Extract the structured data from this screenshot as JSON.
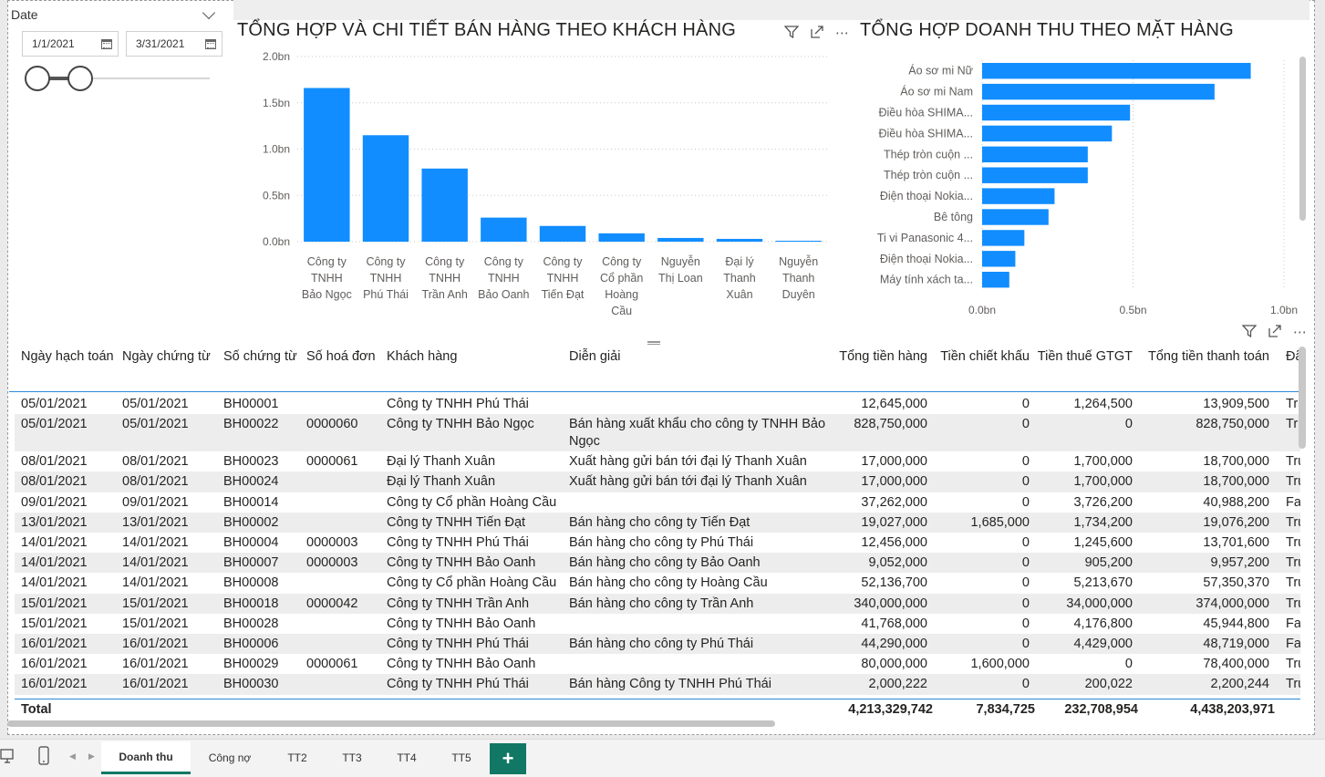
{
  "slicer": {
    "title": "Date",
    "start": "1/1/2021",
    "end": "3/31/2021"
  },
  "chart1": {
    "title": "TỔNG HỢP VÀ CHI TIẾT BÁN HÀNG THEO KHÁCH HÀNG",
    "y_ticks": [
      "2.0bn",
      "1.5bn",
      "1.0bn",
      "0.5bn",
      "0.0bn"
    ]
  },
  "chart2": {
    "title": "TỔNG HỢP DOANH THU THEO MẶT HÀNG",
    "x_ticks": [
      "0.0bn",
      "0.5bn",
      "1.0bn"
    ]
  },
  "chart_data": [
    {
      "type": "bar",
      "title": "TỔNG HỢP VÀ CHI TIẾT BÁN HÀNG THEO KHÁCH HÀNG",
      "categories": [
        [
          "Công ty",
          "TNHH",
          "Bảo Ngọc"
        ],
        [
          "Công ty",
          "TNHH",
          "Phú Thái"
        ],
        [
          "Công ty",
          "TNHH",
          "Trần Anh"
        ],
        [
          "Công ty",
          "TNHH",
          "Bảo Oanh"
        ],
        [
          "Công ty",
          "TNHH",
          "Tiến Đạt"
        ],
        [
          "Công ty",
          "Cổ phần",
          "Hoàng",
          "Cầu"
        ],
        [
          "Nguyễn",
          "Thị Loan"
        ],
        [
          "Đại lý",
          "Thanh",
          "Xuân"
        ],
        [
          "Nguyễn",
          "Thanh",
          "Duyên"
        ]
      ],
      "values": [
        1.66,
        1.15,
        0.79,
        0.26,
        0.17,
        0.09,
        0.04,
        0.03,
        0.01
      ],
      "ylim": [
        0,
        2.0
      ],
      "color": "#118dff"
    },
    {
      "type": "bar",
      "orientation": "horizontal",
      "title": "TỔNG HỢP DOANH THU THEO MẶT HÀNG",
      "categories": [
        "Áo sơ mi Nữ",
        "Áo sơ mi Nam",
        "Điều hòa SHIMA...",
        "Điều hòa SHIMA...",
        "Thép tròn cuộn ...",
        "Thép tròn cuộn ...",
        "Điện thoại Nokia...",
        "Bê tông",
        "Ti vi Panasonic 4...",
        "Điện thoại Nokia...",
        "Máy tính xách ta..."
      ],
      "values": [
        0.89,
        0.77,
        0.49,
        0.43,
        0.35,
        0.35,
        0.24,
        0.22,
        0.14,
        0.11,
        0.09
      ],
      "xlim": [
        0,
        1.0
      ],
      "color": "#118dff"
    }
  ],
  "table": {
    "headers": [
      "Ngày hạch toán",
      "Ngày chứng từ",
      "Số chứng từ",
      "Số hoá đơn",
      "Khách hàng",
      "Diễn giải",
      "Tổng tiền hàng",
      "Tiền chiết khấu",
      "Tiền thuế GTGT",
      "Tổng tiền thanh toán",
      "Đã"
    ],
    "rows": [
      [
        "05/01/2021",
        "05/01/2021",
        "BH00001",
        "",
        "Công ty TNHH Phú Thái",
        "",
        "12,645,000",
        "0",
        "1,264,500",
        "13,909,500",
        "Tru"
      ],
      [
        "05/01/2021",
        "05/01/2021",
        "BH00022",
        "0000060",
        "Công ty TNHH Bảo Ngọc",
        "Bán hàng xuất khẩu cho công ty TNHH Bảo Ngọc",
        "828,750,000",
        "0",
        "0",
        "828,750,000",
        "Tru"
      ],
      [
        "08/01/2021",
        "08/01/2021",
        "BH00023",
        "0000061",
        "Đại lý Thanh Xuân",
        "Xuất hàng gửi bán tới đại lý Thanh Xuân",
        "17,000,000",
        "0",
        "1,700,000",
        "18,700,000",
        "Tru"
      ],
      [
        "08/01/2021",
        "08/01/2021",
        "BH00024",
        "",
        "Đại lý Thanh Xuân",
        "Xuất hàng gửi bán tới đại lý Thanh Xuân",
        "17,000,000",
        "0",
        "1,700,000",
        "18,700,000",
        "Tru"
      ],
      [
        "09/01/2021",
        "09/01/2021",
        "BH00014",
        "",
        "Công ty Cổ phần Hoàng Cầu",
        "",
        "37,262,000",
        "0",
        "3,726,200",
        "40,988,200",
        "Fa"
      ],
      [
        "13/01/2021",
        "13/01/2021",
        "BH00002",
        "",
        "Công ty TNHH Tiến Đạt",
        "Bán hàng cho công ty Tiến Đạt",
        "19,027,000",
        "1,685,000",
        "1,734,200",
        "19,076,200",
        "Tru"
      ],
      [
        "14/01/2021",
        "14/01/2021",
        "BH00004",
        "0000003",
        "Công ty TNHH Phú Thái",
        "Bán hàng cho công ty Phú Thái",
        "12,456,000",
        "0",
        "1,245,600",
        "13,701,600",
        "Tru"
      ],
      [
        "14/01/2021",
        "14/01/2021",
        "BH00007",
        "0000003",
        "Công ty TNHH Bảo Oanh",
        "Bán hàng cho công ty Bảo Oanh",
        "9,052,000",
        "0",
        "905,200",
        "9,957,200",
        "Tru"
      ],
      [
        "14/01/2021",
        "14/01/2021",
        "BH00008",
        "",
        "Công ty Cổ phần Hoàng Cầu",
        "Bán hàng cho công ty Hoàng Cầu",
        "52,136,700",
        "0",
        "5,213,670",
        "57,350,370",
        "Tru"
      ],
      [
        "15/01/2021",
        "15/01/2021",
        "BH00018",
        "0000042",
        "Công ty TNHH Trần Anh",
        "Bán hàng cho công ty Trần Anh",
        "340,000,000",
        "0",
        "34,000,000",
        "374,000,000",
        "Tru"
      ],
      [
        "15/01/2021",
        "15/01/2021",
        "BH00028",
        "",
        "Công ty TNHH Bảo Oanh",
        "",
        "41,768,000",
        "0",
        "4,176,800",
        "45,944,800",
        "Fa"
      ],
      [
        "16/01/2021",
        "16/01/2021",
        "BH00006",
        "",
        "Công ty TNHH Phú Thái",
        "Bán hàng cho công ty Phú Thái",
        "44,290,000",
        "0",
        "4,429,000",
        "48,719,000",
        "Fa"
      ],
      [
        "16/01/2021",
        "16/01/2021",
        "BH00029",
        "0000061",
        "Công ty TNHH Bảo Oanh",
        "",
        "80,000,000",
        "1,600,000",
        "0",
        "78,400,000",
        "Tru"
      ],
      [
        "16/01/2021",
        "16/01/2021",
        "BH00030",
        "",
        "Công ty TNHH Phú Thái",
        "Bán hàng Công ty TNHH Phú Thái",
        "2,000,222",
        "0",
        "200,022",
        "2,200,244",
        "Tru"
      ]
    ],
    "total": {
      "label": "Total",
      "tong_tien_hang": "4,213,329,742",
      "tien_chiet_khau": "7,834,725",
      "tien_thue": "232,708,954",
      "tong_thanh_toan": "4,438,203,971"
    }
  },
  "tabs": [
    "Doanh thu",
    "Công nợ",
    "TT2",
    "TT3",
    "TT4",
    "TT5"
  ],
  "add_tab_label": "+",
  "icons": [
    "filter-icon",
    "focus-mode-icon",
    "more-options-icon",
    "calendar-icon",
    "desktop-layout-icon",
    "mobile-layout-icon"
  ]
}
